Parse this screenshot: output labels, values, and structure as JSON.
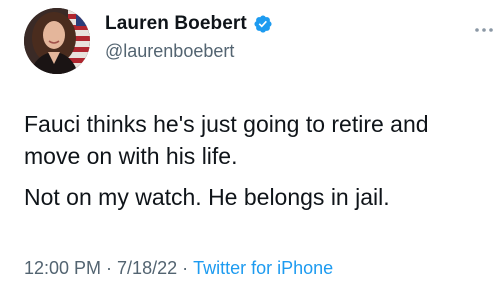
{
  "author": {
    "display_name": "Lauren Boebert",
    "handle": "@laurenboebert",
    "verified_icon": "verified-badge-icon",
    "avatar": "profile-photo-avatar"
  },
  "more_icon": "more-options-icon",
  "tweet": {
    "paragraphs": [
      "Fauci thinks he's just going to retire and move on with his life.",
      "Not on my watch. He belongs in jail."
    ]
  },
  "meta": {
    "time": "12:00 PM",
    "separator": "·",
    "date": "7/18/22",
    "source": "Twitter for iPhone"
  },
  "colors": {
    "text": "#0f1419",
    "secondary": "#536471",
    "accent": "#1d9bf0"
  }
}
